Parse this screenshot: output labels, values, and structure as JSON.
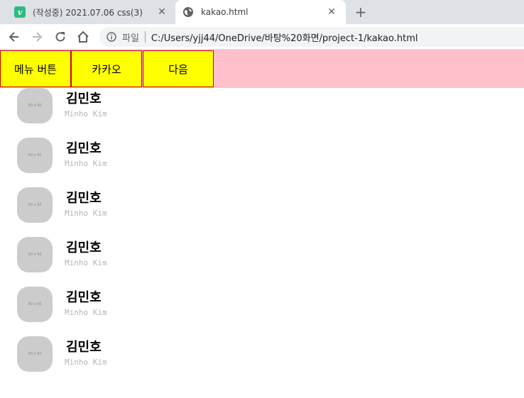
{
  "browser": {
    "tabs": [
      {
        "title": "(작성중) 2021.07.06 css(3)",
        "favicon": "v-logo-icon",
        "active": false
      },
      {
        "title": "kakao.html",
        "favicon": "globe-icon",
        "active": true
      }
    ],
    "new_tab_label": "+",
    "close_label": "✕",
    "address_bar": {
      "scheme_label": "파일",
      "url": "C:/Users/yjj44/OneDrive/바탕%20화면/project-1/kakao.html"
    }
  },
  "menu": {
    "buttons": [
      "메뉴 버튼",
      "카카오",
      "다음"
    ],
    "background_color": "#ffc0cb",
    "button_color": "#ffff00",
    "button_border_color": "#cc0000"
  },
  "friends": [
    {
      "name": "김민호",
      "subtitle": "Minho Kim",
      "avatar_text": "50 x 50"
    },
    {
      "name": "김민호",
      "subtitle": "Minho Kim",
      "avatar_text": "50 x 50"
    },
    {
      "name": "김민호",
      "subtitle": "Minho Kim",
      "avatar_text": "50 x 50"
    },
    {
      "name": "김민호",
      "subtitle": "Minho Kim",
      "avatar_text": "50 x 50"
    },
    {
      "name": "김민호",
      "subtitle": "Minho Kim",
      "avatar_text": "50 x 50"
    },
    {
      "name": "김민호",
      "subtitle": "Minho Kim",
      "avatar_text": "50 x 50"
    }
  ]
}
